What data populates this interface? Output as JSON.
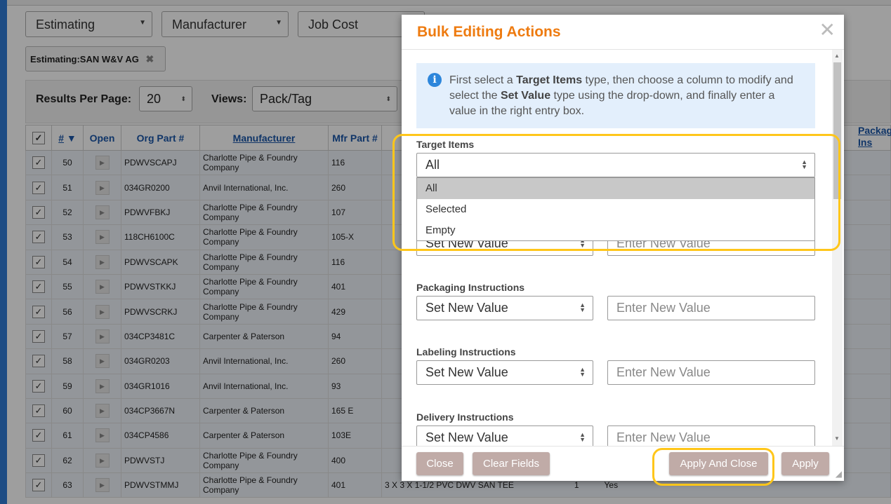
{
  "filters": [
    {
      "label": "Estimating"
    },
    {
      "label": "Manufacturer"
    },
    {
      "label": "Job Cost"
    }
  ],
  "chip": {
    "label_bold": "Estimating:",
    "value": "SAN W&V AG",
    "remove_icon": "close-icon"
  },
  "results": {
    "per_page_label": "Results Per Page:",
    "per_page_value": "20",
    "views_label": "Views:",
    "views_value": "Pack/Tag"
  },
  "grid": {
    "headers": [
      "#",
      "Open",
      "Org Part #",
      "Manufacturer",
      "Mfr Part #"
    ],
    "right_header": "Packag\nIns",
    "rows": [
      {
        "num": "50",
        "part": "PDWVSCAPJ",
        "mfr": "Charlotte Pipe & Foundry Company",
        "mfr_part": "116"
      },
      {
        "num": "51",
        "part": "034GR0200",
        "mfr": "Anvil International, Inc.",
        "mfr_part": "260"
      },
      {
        "num": "52",
        "part": "PDWVFBKJ",
        "mfr": "Charlotte Pipe & Foundry Company",
        "mfr_part": "107"
      },
      {
        "num": "53",
        "part": "118CH6100C",
        "mfr": "Charlotte Pipe & Foundry Company",
        "mfr_part": "105-X"
      },
      {
        "num": "54",
        "part": "PDWVSCAPK",
        "mfr": "Charlotte Pipe & Foundry Company",
        "mfr_part": "116"
      },
      {
        "num": "55",
        "part": "PDWVSTKKJ",
        "mfr": "Charlotte Pipe & Foundry Company",
        "mfr_part": "401"
      },
      {
        "num": "56",
        "part": "PDWVSCRKJ",
        "mfr": "Charlotte Pipe & Foundry Company",
        "mfr_part": "429"
      },
      {
        "num": "57",
        "part": "034CP3481C",
        "mfr": "Carpenter & Paterson",
        "mfr_part": "94"
      },
      {
        "num": "58",
        "part": "034GR0203",
        "mfr": "Anvil International, Inc.",
        "mfr_part": "260"
      },
      {
        "num": "59",
        "part": "034GR1016",
        "mfr": "Anvil International, Inc.",
        "mfr_part": "93"
      },
      {
        "num": "60",
        "part": "034CP3667N",
        "mfr": "Carpenter & Paterson",
        "mfr_part": "165 E"
      },
      {
        "num": "61",
        "part": "034CP4586",
        "mfr": "Carpenter & Paterson",
        "mfr_part": "103E"
      },
      {
        "num": "62",
        "part": "PDWVSTJ",
        "mfr": "Charlotte Pipe & Foundry Company",
        "mfr_part": "400"
      },
      {
        "num": "63",
        "part": "PDWVSTMMJ",
        "mfr": "Charlotte Pipe & Foundry Company",
        "mfr_part": "401"
      }
    ],
    "row63_desc": "3 X 3 X 1-1/2 PVC DWV SAN TEE",
    "row63_qty": "1",
    "row63_yes": "Yes"
  },
  "modal": {
    "title": "Bulk Editing Actions",
    "info_text_1": "First select a ",
    "info_bold_1": "Target Items",
    "info_text_2": " type, then choose a column to modify and select the ",
    "info_bold_2": "Set Value",
    "info_text_3": " type using the drop-down, and finally enter a value in the right entry box.",
    "target_label": "Target Items",
    "target_value": "All",
    "target_options": [
      "All",
      "Selected",
      "Empty"
    ],
    "set_new_value": "Set New Value",
    "enter_new_value": "Enter New Value",
    "fields": [
      {
        "label": "Packaging Instructions"
      },
      {
        "label": "Labeling Instructions"
      },
      {
        "label": "Delivery Instructions"
      }
    ],
    "buttons": {
      "close": "Close",
      "clear": "Clear Fields",
      "apply_close": "Apply And Close",
      "apply": "Apply"
    }
  },
  "colors": {
    "title_orange": "#ee7b10",
    "highlight_yellow": "#ffc61a",
    "button_bg": "#c0aba7",
    "info_bg": "#e3effc"
  }
}
